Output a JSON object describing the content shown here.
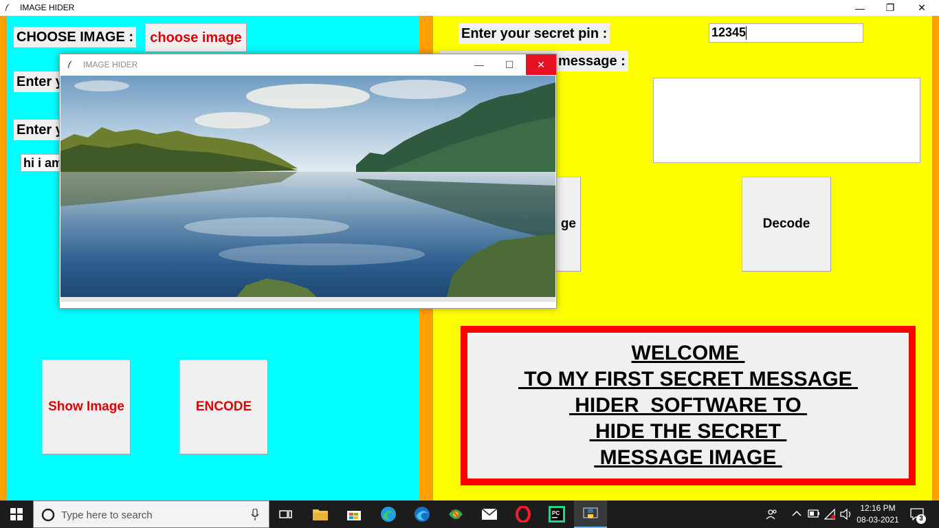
{
  "main_window": {
    "title": "IMAGE HIDER",
    "controls": {
      "minimize": "—",
      "restore": "❐",
      "close": "✕"
    }
  },
  "left": {
    "choose_label": "CHOOSE IMAGE :",
    "choose_button": "choose image",
    "enter_label_1": "Enter y",
    "enter_label_2": "Enter y",
    "message_value": "hi i am",
    "show_image_button": "Show Image",
    "encode_button": "ENCODE"
  },
  "right": {
    "pin_label": "Enter your secret pin :",
    "pin_value": "12345",
    "message_label_partial": "message :",
    "message_box_value": "",
    "show_image_partial": "ge",
    "decode_button": "Decode"
  },
  "welcome": {
    "lines": [
      "WELCOME ",
      " TO MY FIRST SECRET MESSAGE ",
      " HIDER  SOFTWARE TO ",
      " HIDE THE SECRET ",
      " MESSAGE IMAGE "
    ]
  },
  "popup": {
    "title": "IMAGE HIDER",
    "controls": {
      "minimize": "—",
      "maximize": "☐",
      "close": "✕"
    }
  },
  "taskbar": {
    "search_placeholder": "Type here to search",
    "time": "12:16 PM",
    "date": "08-03-2021",
    "notification_count": "3",
    "apps": [
      "task-view-icon",
      "file-explorer-icon",
      "store-icon",
      "edge-icon",
      "edge-dev-icon",
      "photos-icon",
      "mail-icon",
      "opera-icon",
      "pycharm-icon",
      "python-icon"
    ]
  },
  "colors": {
    "left_panel": "#00ffff",
    "right_panel": "#ffff00",
    "frame": "#ff9f00",
    "red_text": "#e00000",
    "welcome_border": "#ff0000"
  }
}
